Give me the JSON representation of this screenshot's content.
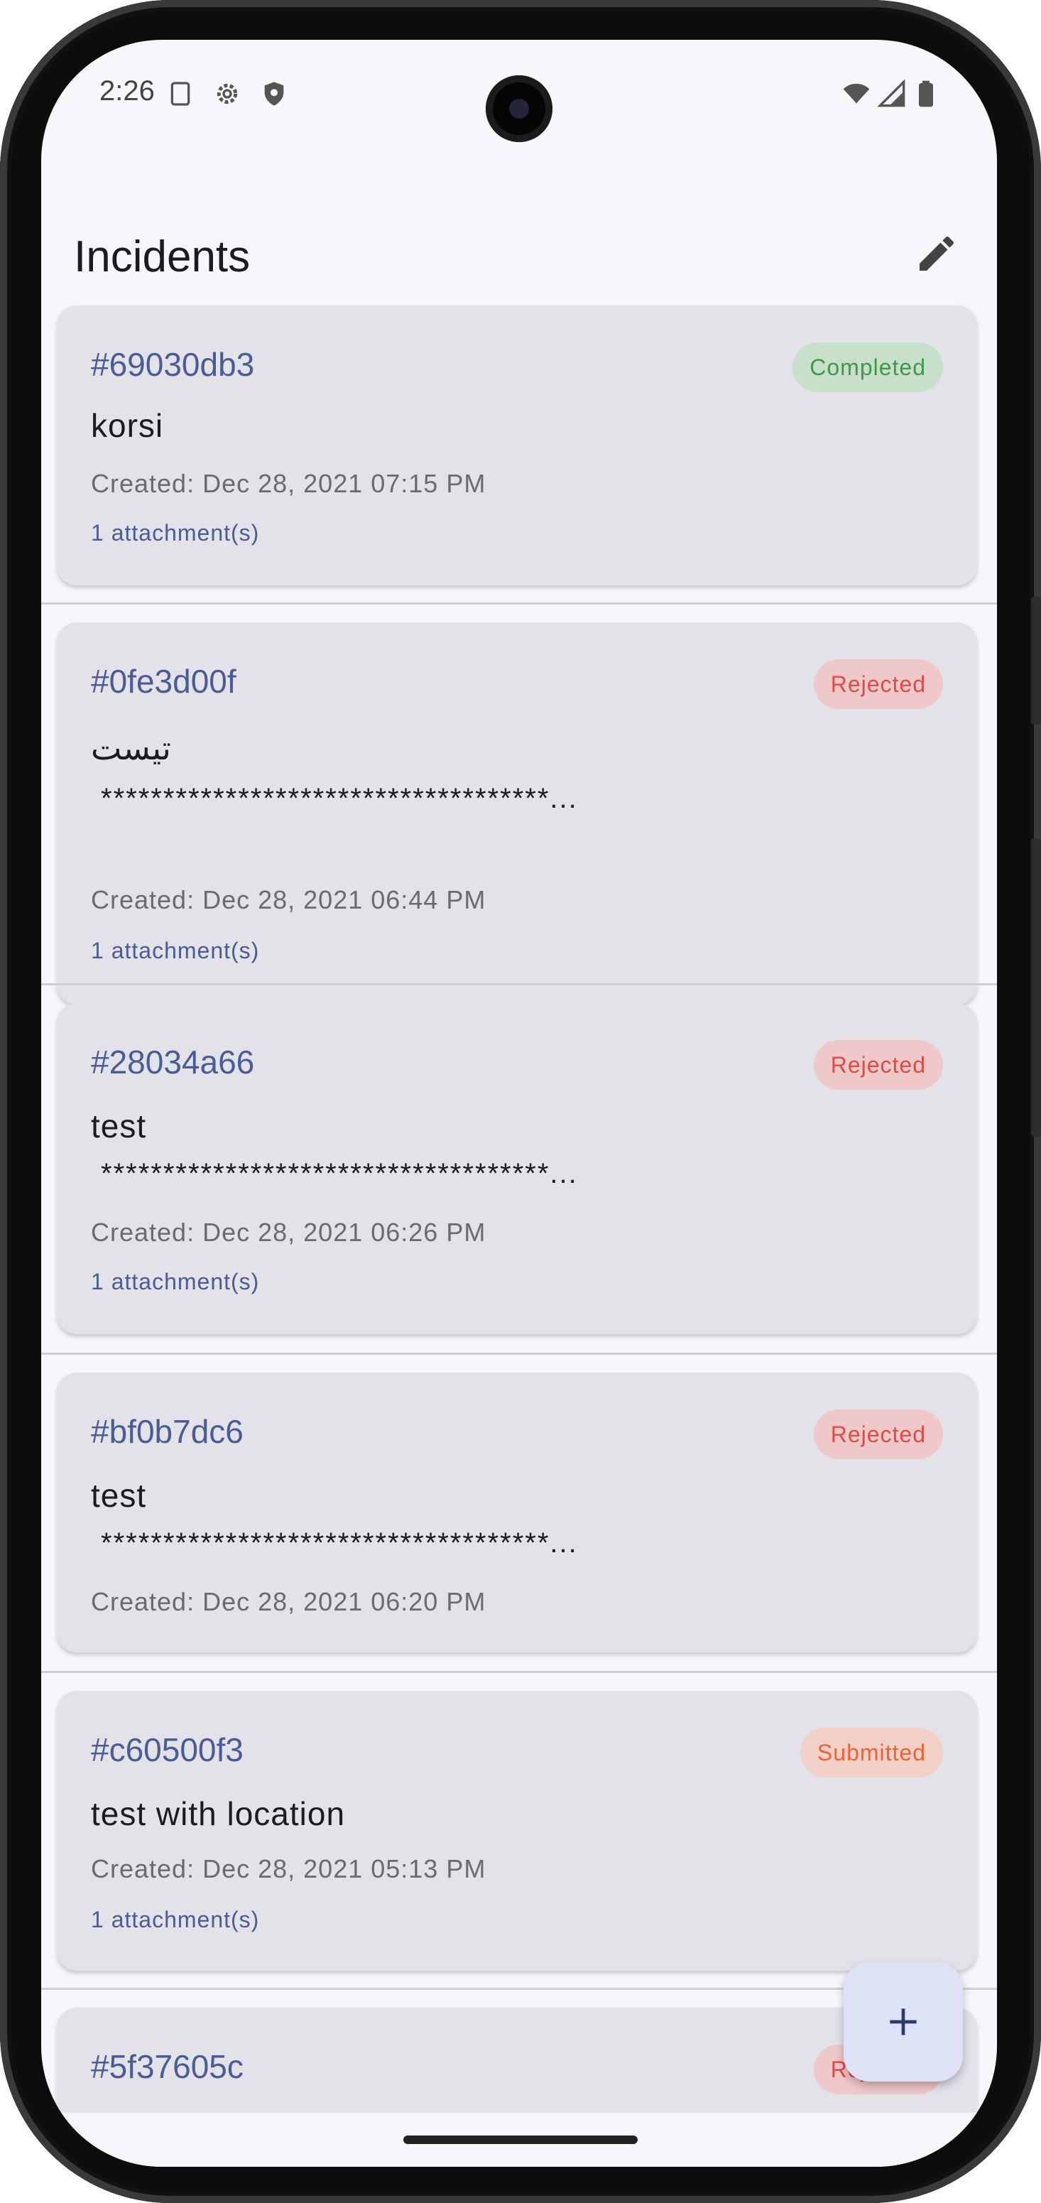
{
  "status_bar": {
    "time": "2:26"
  },
  "header": {
    "title": "Incidents"
  },
  "incidents": [
    {
      "id": "#69030db3",
      "status": "Completed",
      "title": "korsi",
      "desc": "",
      "created": "Created: Dec 28, 2021 07:15 PM",
      "attachments": "1 attachment(s)"
    },
    {
      "id": "#0fe3d00f",
      "status": "Rejected",
      "title": "تیست",
      "desc": "************************************...",
      "created": "Created: Dec 28, 2021 06:44 PM",
      "attachments": "1 attachment(s)"
    },
    {
      "id": "#28034a66",
      "status": "Rejected",
      "title": "test",
      "desc": "************************************...",
      "created": "Created: Dec 28, 2021 06:26 PM",
      "attachments": "1 attachment(s)"
    },
    {
      "id": "#bf0b7dc6",
      "status": "Rejected",
      "title": "test",
      "desc": "************************************...",
      "created": "Created: Dec 28, 2021 06:20 PM",
      "attachments": ""
    },
    {
      "id": "#c60500f3",
      "status": "Submitted",
      "title": "test with location",
      "desc": "",
      "created": "Created: Dec 28, 2021 05:13 PM",
      "attachments": "1 attachment(s)"
    },
    {
      "id": "#5f37605c",
      "status": "Rejected"
    }
  ],
  "icons": {
    "edit": "pencil-icon",
    "fab": "plus-icon"
  },
  "colors": {
    "accent": "#4a5c94",
    "completed": "#3d9a4b",
    "rejected": "#e14a45",
    "submitted": "#ef6232"
  }
}
